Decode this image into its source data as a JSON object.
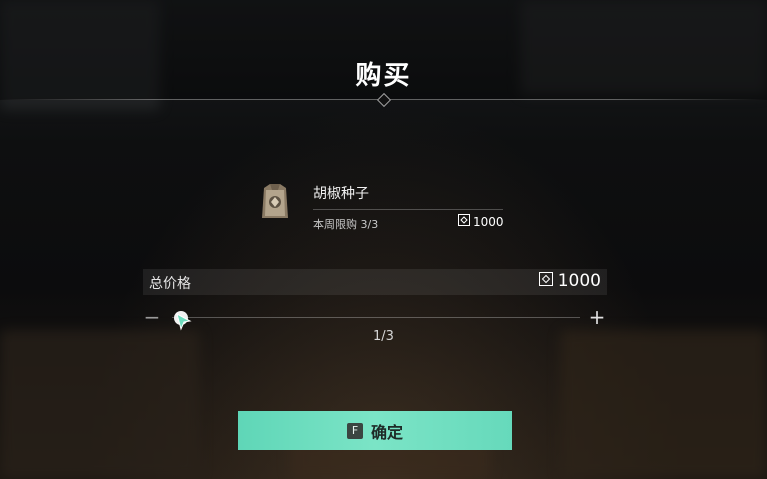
{
  "dialog": {
    "title": "购买"
  },
  "item": {
    "name": "胡椒种子",
    "icon": "seed-bag-icon",
    "weekly_limit": "本周限购 3/3",
    "unit_price": "1000",
    "currency_icon": "currency-icon"
  },
  "total": {
    "label": "总价格",
    "price": "1000"
  },
  "quantity": {
    "minus_symbol": "−",
    "plus_symbol": "+",
    "value": "1/3",
    "fraction": 0.0
  },
  "confirm": {
    "key": "F",
    "label": "确定"
  },
  "colors": {
    "accent": "#6fdcbf",
    "title_text": "#ffffff"
  }
}
